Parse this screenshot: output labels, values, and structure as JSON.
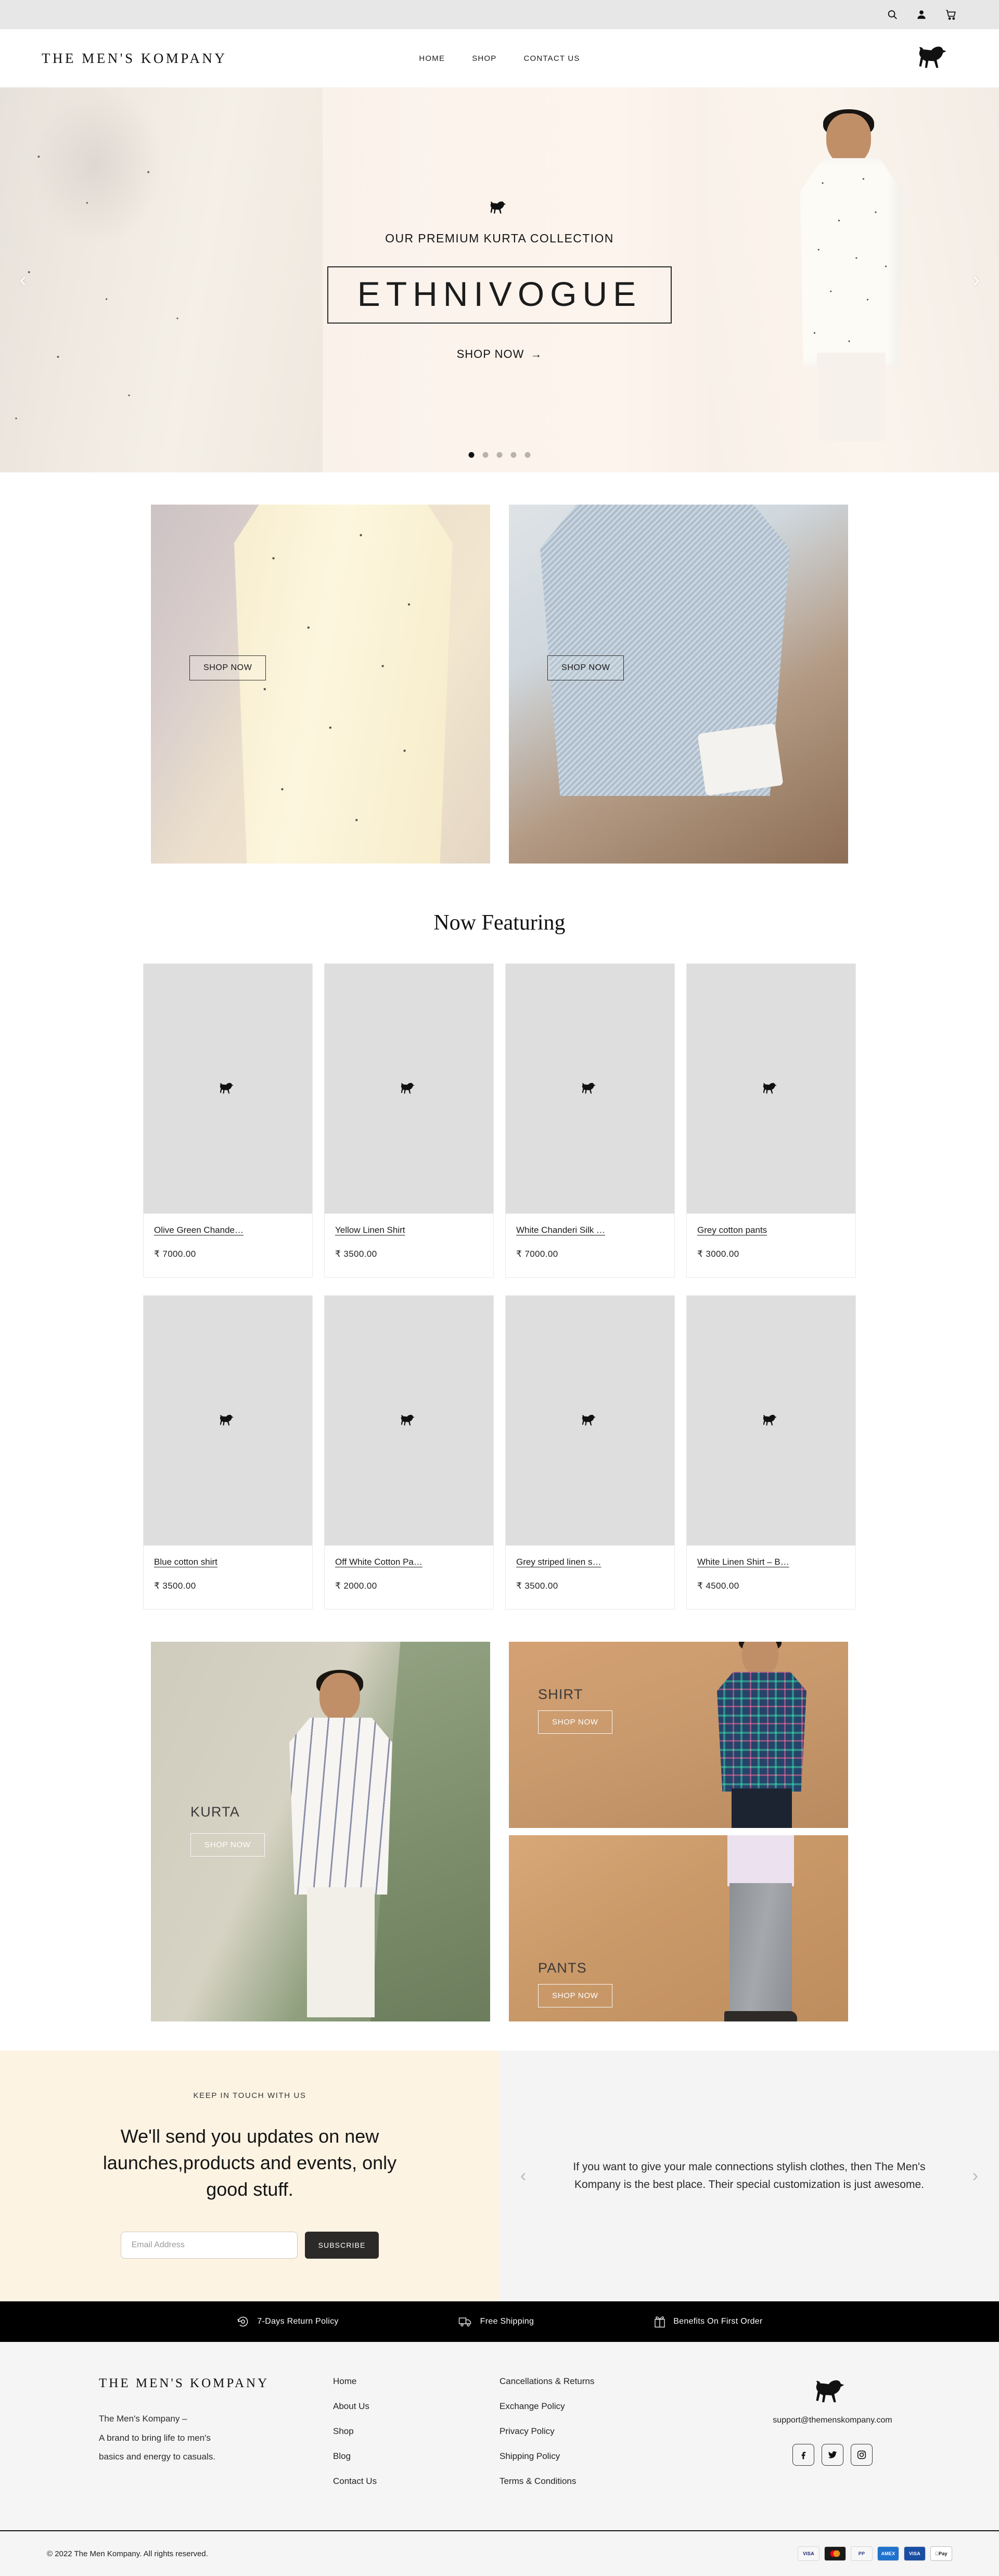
{
  "topbar": {
    "icons": [
      "search-icon",
      "account-icon",
      "cart-icon"
    ]
  },
  "header": {
    "brand": "THE MEN'S KOMPANY",
    "nav": [
      {
        "label": "HOME"
      },
      {
        "label": "SHOP"
      },
      {
        "label": "CONTACT US"
      }
    ],
    "logo": "bull-logo"
  },
  "hero": {
    "kicker": "OUR PREMIUM KURTA COLLECTION",
    "title": "ETHNIVOGUE",
    "cta": "SHOP NOW",
    "cta_arrow": "→",
    "prev": "‹",
    "next": "›",
    "dots": 5,
    "active_dot": 0
  },
  "promos": [
    {
      "button": "SHOP NOW"
    },
    {
      "button": "SHOP NOW"
    }
  ],
  "featuring": {
    "heading": "Now Featuring",
    "products": [
      {
        "title": "Olive Green Chande…",
        "price": "₹ 7000.00"
      },
      {
        "title": "Yellow Linen Shirt",
        "price": "₹ 3500.00"
      },
      {
        "title": "White Chanderi Silk …",
        "price": "₹ 7000.00"
      },
      {
        "title": "Grey cotton pants",
        "price": "₹ 3000.00"
      },
      {
        "title": "Blue cotton shirt",
        "price": "₹ 3500.00"
      },
      {
        "title": "Off White Cotton Pa…",
        "price": "₹ 2000.00"
      },
      {
        "title": "Grey striped linen s…",
        "price": "₹ 3500.00"
      },
      {
        "title": "White Linen Shirt – B…",
        "price": "₹ 4500.00"
      }
    ]
  },
  "categories": [
    {
      "label": "KURTA",
      "button": "SHOP NOW"
    },
    {
      "label": "SHIRT",
      "button": "SHOP NOW"
    },
    {
      "label": "PANTS",
      "button": "SHOP NOW"
    }
  ],
  "newsletter": {
    "kicker": "KEEP IN TOUCH WITH US",
    "heading": "We'll send you updates on new launches,products and events, only good stuff.",
    "placeholder": "Email Address",
    "value": "",
    "button": "SUBSCRIBE"
  },
  "testimonial": {
    "text": "If you want to give your male connections stylish clothes, then The Men's Kompany is the best place. Their special customization is just awesome.",
    "prev": "‹",
    "next": "›"
  },
  "strip": [
    {
      "icon": "return-policy-icon",
      "label": "7-Days Return Policy"
    },
    {
      "icon": "free-shipping-icon",
      "label": "Free Shipping"
    },
    {
      "icon": "gift-benefits-icon",
      "label": "Benefits On First Order"
    }
  ],
  "footer": {
    "brand": "THE MEN'S KOMPANY",
    "description_line1": "The Men's Kompany –",
    "description_line2": "A brand to bring life to men's",
    "description_line3": "basics and energy to casuals.",
    "nav": [
      {
        "label": "Home"
      },
      {
        "label": "About Us"
      },
      {
        "label": "Shop"
      },
      {
        "label": "Blog"
      },
      {
        "label": "Contact Us"
      }
    ],
    "policies": [
      {
        "label": "Cancellations & Returns"
      },
      {
        "label": "Exchange Policy"
      },
      {
        "label": "Privacy Policy"
      },
      {
        "label": "Shipping Policy"
      },
      {
        "label": "Terms & Conditions"
      }
    ],
    "email": "support@themenskompany.com",
    "socials": [
      {
        "name": "facebook-icon"
      },
      {
        "name": "twitter-icon"
      },
      {
        "name": "instagram-icon"
      }
    ]
  },
  "copyright": {
    "text": "© 2022 The Men Kompany. All rights reserved.",
    "payments": [
      {
        "label": "VISA"
      },
      {
        "label": "MC"
      },
      {
        "label": "PP"
      },
      {
        "label": "AMEX"
      },
      {
        "label": "VISA"
      },
      {
        "label": "Pay"
      }
    ]
  },
  "colors": {
    "accent_cream": "#fdf3e3",
    "strip_bg": "#000000",
    "footer_bg": "#f5f5f5",
    "placeholder_grey": "#dedede",
    "topbar_grey": "#e7e7e7"
  }
}
